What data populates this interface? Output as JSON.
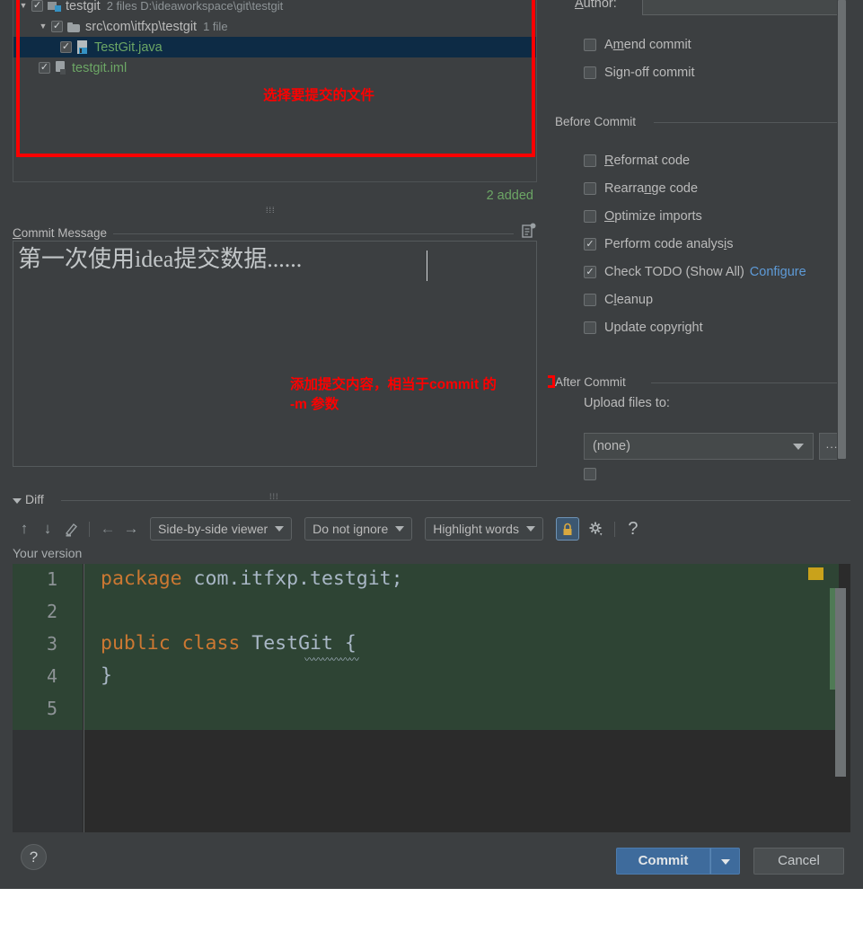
{
  "tree": {
    "rows": [
      {
        "indent": 0,
        "twisty": "▼",
        "checked": true,
        "icon": "module-icon",
        "name": "testgit",
        "sub": "2 files  D:\\ideaworkspace\\git\\testgit",
        "green": false,
        "selected": false
      },
      {
        "indent": 1,
        "twisty": "▼",
        "checked": true,
        "icon": "folder-icon",
        "name": "src\\com\\itfxp\\testgit",
        "sub": "1 file",
        "green": false,
        "selected": false
      },
      {
        "indent": 2,
        "twisty": "",
        "checked": true,
        "icon": "java-class-icon",
        "name": "TestGit.java",
        "sub": "",
        "green": true,
        "selected": true
      },
      {
        "indent": 1,
        "twisty": "",
        "checked": true,
        "icon": "iml-file-icon",
        "name": "testgit.iml",
        "sub": "",
        "green": true,
        "selected": false
      }
    ],
    "annotation": "选择要提交的文件",
    "added_count_label": "2 added"
  },
  "commit_message": {
    "title": "Commit Message",
    "title_mnemonic": "C",
    "title_rest": "ommit Message",
    "value": "第一次使用idea提交数据......",
    "annotation_line1": "添加提交内容，相当于commit 的",
    "annotation_line2": "-m 参数"
  },
  "right_panel": {
    "author_label": "Author:",
    "author_mnemonic": "A",
    "author_rest": "uthor:",
    "author_value": "",
    "top_checkboxes": [
      {
        "label_pre": "A",
        "label_mn": "m",
        "label_post": "end commit",
        "label": "Amend commit",
        "checked": false
      },
      {
        "label_pre": "Si",
        "label_mn": "g",
        "label_post": "n-off commit",
        "label": "Sign-off commit",
        "checked": false
      }
    ],
    "before_commit": {
      "title": "Before Commit",
      "items": [
        {
          "label_pre": "",
          "label_mn": "R",
          "label_post": "eformat code",
          "label": "Reformat code",
          "checked": false,
          "link": ""
        },
        {
          "label_pre": "Rearra",
          "label_mn": "n",
          "label_post": "ge code",
          "label": "Rearrange code",
          "checked": false,
          "link": ""
        },
        {
          "label_pre": "",
          "label_mn": "O",
          "label_post": "ptimize imports",
          "label": "Optimize imports",
          "checked": false,
          "link": ""
        },
        {
          "label_pre": "Perform code analys",
          "label_mn": "i",
          "label_post": "s",
          "label": "Perform code analysis",
          "checked": true,
          "link": ""
        },
        {
          "label_pre": "Check TODO (Show All)",
          "label_mn": "",
          "label_post": "",
          "label": "Check TODO (Show All)",
          "checked": true,
          "link": "Configure"
        },
        {
          "label_pre": "C",
          "label_mn": "l",
          "label_post": "eanup",
          "label": "Cleanup",
          "checked": false,
          "link": ""
        },
        {
          "label_pre": "Update copyright",
          "label_mn": "",
          "label_post": "",
          "label": "Update copyright",
          "checked": false,
          "link": ""
        }
      ]
    },
    "after_commit": {
      "title": "After Commit",
      "upload_label": "Upload files to:",
      "upload_value": "(none)",
      "browse_label": "..."
    }
  },
  "diff": {
    "section_title": "Diff",
    "toolbar": {
      "prev_diff_icon": "↑",
      "next_diff_icon": "↓",
      "edit_icon": "✎",
      "accept_left_icon": "←",
      "accept_right_icon": "→",
      "viewer_mode": "Side-by-side viewer",
      "ignore_mode": "Do not ignore",
      "highlight_mode": "Highlight words",
      "lock_icon": "lock-icon",
      "settings_icon": "gear-icon",
      "help_icon": "?"
    },
    "version_label": "Your version",
    "code": {
      "line_numbers": [
        "1",
        "2",
        "3",
        "4",
        "5"
      ],
      "lines": [
        {
          "tokens": [
            {
              "t": "package",
              "c": "kw"
            },
            {
              "t": " com.itfxp.testgit;",
              "c": "pl"
            }
          ]
        },
        {
          "tokens": []
        },
        {
          "tokens": [
            {
              "t": "public class",
              "c": "kw"
            },
            {
              "t": " TestGit {",
              "c": "pl"
            }
          ]
        },
        {
          "tokens": [
            {
              "t": "}",
              "c": "pl"
            }
          ]
        },
        {
          "tokens": []
        }
      ]
    }
  },
  "footer": {
    "help_label": "?",
    "commit_label": "Commit",
    "cancel_label": "Cancel"
  },
  "colors": {
    "dialog_bg": "#3c3f41",
    "selection_bg": "#0d2b45",
    "added_green": "#6ca665",
    "annotation_red": "#fe0000",
    "link_blue": "#5e9bd8",
    "accent_button": "#3e6b9c",
    "diff_added_bg": "#2e4434",
    "editor_bg": "#2b2b2b",
    "keyword_orange": "#cc7832",
    "error_marker": "#c9a21b"
  }
}
